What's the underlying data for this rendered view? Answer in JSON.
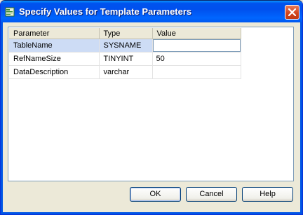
{
  "window": {
    "title": "Specify Values for Template Parameters"
  },
  "grid": {
    "columns": [
      "Parameter",
      "Type",
      "Value"
    ],
    "rows": [
      {
        "parameter": "TableName",
        "type": "SYSNAME",
        "value": ""
      },
      {
        "parameter": "RefNameSize",
        "type": "TINYINT",
        "value": "50"
      },
      {
        "parameter": "DataDescription",
        "type": "varchar",
        "value": ""
      }
    ]
  },
  "buttons": {
    "ok": "OK",
    "cancel": "Cancel",
    "help": "Help"
  },
  "colors": {
    "titlebar": "#0055e5",
    "selection": "#cddcf5",
    "close": "#d1431a"
  }
}
